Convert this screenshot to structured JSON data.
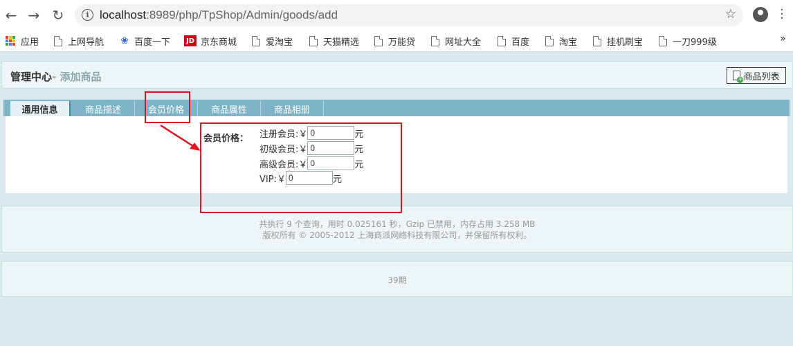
{
  "browser": {
    "url_host": "localhost",
    "url_path": ":8989/php/TpShop/Admin/goods/add",
    "bookmarks": [
      {
        "label": "应用",
        "icon": "apps-grid-icon"
      },
      {
        "label": "上网导航",
        "icon": "page-icon"
      },
      {
        "label": "百度一下",
        "icon": "baidu-paw-icon"
      },
      {
        "label": "京东商城",
        "icon": "jd-icon"
      },
      {
        "label": "爱淘宝",
        "icon": "page-icon"
      },
      {
        "label": "天猫精选",
        "icon": "page-icon"
      },
      {
        "label": "万能贷",
        "icon": "page-icon"
      },
      {
        "label": "网址大全",
        "icon": "page-icon"
      },
      {
        "label": "百度",
        "icon": "page-icon"
      },
      {
        "label": "淘宝",
        "icon": "page-icon"
      },
      {
        "label": "挂机刷宝",
        "icon": "page-icon"
      },
      {
        "label": "一刀999级",
        "icon": "page-icon"
      }
    ],
    "more": "»"
  },
  "header": {
    "title": "管理中心",
    "subtitle": "- 添加商品",
    "list_button": "商品列表"
  },
  "tabs": [
    {
      "label": "通用信息",
      "active": true
    },
    {
      "label": "商品描述",
      "active": false
    },
    {
      "label": "会员价格",
      "active": false
    },
    {
      "label": "商品属性",
      "active": false
    },
    {
      "label": "商品相册",
      "active": false
    }
  ],
  "member_price": {
    "label": "会员价格：",
    "rows": [
      {
        "label": "注册会员:￥",
        "value": "0",
        "unit": "元"
      },
      {
        "label": "初级会员:￥",
        "value": "0",
        "unit": "元"
      },
      {
        "label": "高级会员:￥",
        "value": "0",
        "unit": "元"
      },
      {
        "label": "VIP:￥",
        "value": "0",
        "unit": "元"
      }
    ]
  },
  "footer": {
    "line1": "共执行 9 个查询，用时 0.025161 秒，Gzip 已禁用，内存占用 3.258 MB",
    "line2": "版权所有 © 2005-2012 上海商派网络科技有限公司，并保留所有权利。",
    "period": "39期"
  },
  "colors": {
    "annotation": "#e0141e",
    "tab_bar": "#7fb3c7"
  }
}
